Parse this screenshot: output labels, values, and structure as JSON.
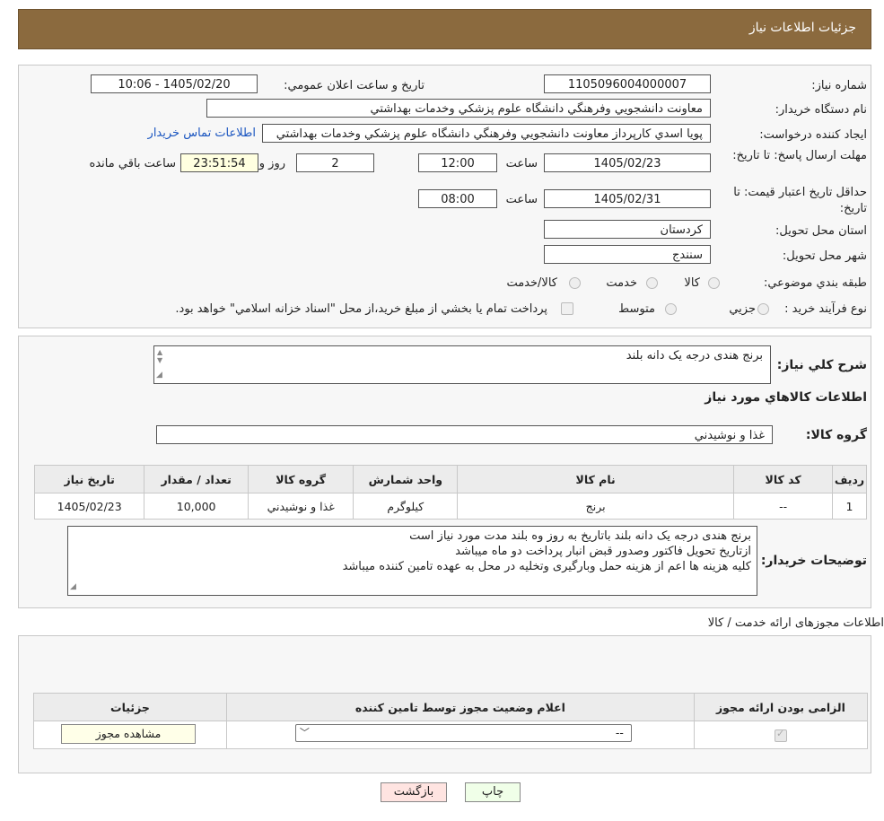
{
  "header": {
    "title": "جزئيات اطلاعات نياز"
  },
  "form": {
    "need_number_label": "شماره نياز:",
    "need_number": "1105096004000007",
    "announce_label": "تاريخ و ساعت اعلان عمومي:",
    "announce_value": "1405/02/20 - 10:06",
    "buyer_label": "نام دستگاه خريدار:",
    "buyer_value": "معاونت دانشجويي وفرهنگي دانشگاه علوم پزشكي وخدمات بهداشتي",
    "creator_label": "ايجاد كننده درخواست:",
    "creator_value": "پويا اسدي كارپرداز معاونت دانشجويي وفرهنگي دانشگاه علوم پزشكي وخدمات بهداشتي",
    "contact_link": "اطلاعات تماس خريدار",
    "deadline_label": "مهلت ارسال پاسخ: تا تاريخ:",
    "deadline_date": "1405/02/23",
    "time_label": "ساعت",
    "deadline_time": "12:00",
    "days_value": "2",
    "days_label": "روز و",
    "remaining_time": "23:51:54",
    "remaining_label": "ساعت باقي مانده",
    "validity_label": "حداقل تاريخ اعتبار قيمت: تا تاريخ:",
    "validity_date": "1405/02/31",
    "validity_time": "08:00",
    "province_label": "استان محل تحويل:",
    "province_value": "كردستان",
    "city_label": "شهر محل تحويل:",
    "city_value": "سنندج",
    "category_label": "طبقه بندي موضوعي:",
    "category_options": [
      "كالا",
      "خدمت",
      "كالا/خدمت"
    ],
    "process_label": "نوع فرآيند خريد :",
    "process_options": [
      "جزيي",
      "متوسط"
    ],
    "process_note": "پرداخت تمام يا بخشي از مبلغ خريد،از محل \"اسناد خزانه اسلامي\" خواهد بود."
  },
  "summary": {
    "desc_label": "شرح كلي نياز:",
    "desc_value": "برنج هندی درجه یک دانه بلند",
    "goods_title": "اطلاعات كالاهاي مورد نياز",
    "group_label": "گروه كالا:",
    "group_value": "غذا و نوشيدني",
    "table_headers": [
      "رديف",
      "كد كالا",
      "نام كالا",
      "واحد شمارش",
      "گروه كالا",
      "تعداد / مقدار",
      "تاريخ نياز"
    ],
    "table_rows": [
      [
        "1",
        "--",
        "برنج",
        "كيلوگرم",
        "غذا و نوشيدني",
        "10,000",
        "1405/02/23"
      ]
    ],
    "buyer_notes_label": "توضيحات خريدار:",
    "buyer_notes": [
      "برنج هندی درجه یک دانه بلند باتاریخ به روز  وه بلند مدت مورد نیاز است",
      "ازتاریخ تحویل فاکتور وصدور قبض انبار پرداخت دو ماه میباشد",
      "کلیه هزینه ها اعم از هزینه حمل وبارگیری وتخلیه در محل به عهده تامین کننده میباشد"
    ]
  },
  "permits": {
    "title": "اطلاعات مجوزهای ارائه خدمت / کالا",
    "headers": [
      "الزامی بودن ارائه مجوز",
      "اعلام وضعیت مجوز توسط تامین کننده",
      "جزئیات"
    ],
    "select_value": "--",
    "view_button": "مشاهده مجوز"
  },
  "buttons": {
    "print": "چاپ",
    "back": "بازگشت"
  },
  "colors": {
    "header": "#8b6a3e",
    "link": "#1a55c0",
    "back_button": "#ffe4e1",
    "print_button": "#f0ffe8"
  }
}
